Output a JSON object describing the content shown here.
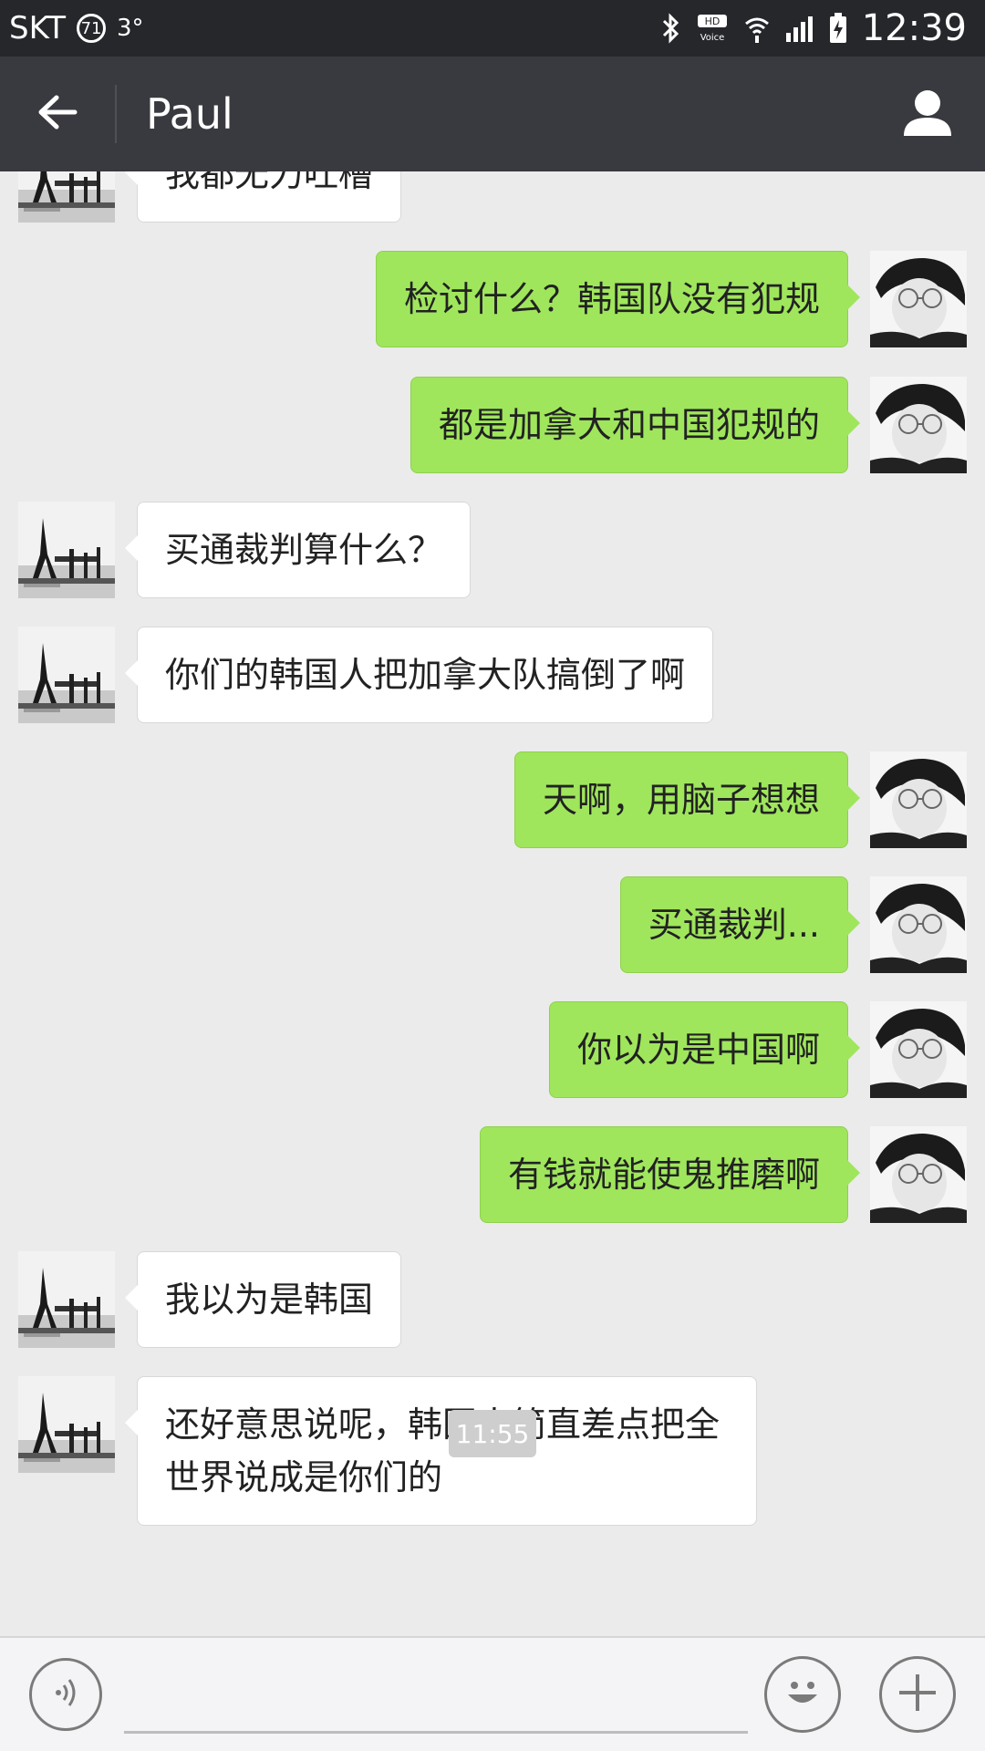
{
  "status_bar": {
    "carrier": "SKT",
    "badge": "71",
    "temperature": "3°",
    "hd_voice": "HD",
    "voice_label": "Voice",
    "time": "12:39"
  },
  "header": {
    "title": "Paul"
  },
  "messages": [
    {
      "side": "left",
      "text": "我都无力吐槽"
    },
    {
      "side": "right",
      "text": "检讨什么？韩国队没有犯规"
    },
    {
      "side": "right",
      "text": "都是加拿大和中国犯规的"
    },
    {
      "side": "left",
      "text": "买通裁判算什么？"
    },
    {
      "side": "left",
      "text": "你们的韩国人把加拿大队搞倒了啊"
    },
    {
      "side": "right",
      "text": "天啊，用脑子想想"
    },
    {
      "side": "right",
      "text": "买通裁判..."
    },
    {
      "side": "right",
      "text": "你以为是中国啊"
    },
    {
      "side": "right",
      "text": "有钱就能使鬼推磨啊"
    },
    {
      "side": "left",
      "text": "我以为是韩国"
    },
    {
      "side": "left",
      "text": "还好意思说呢，韩国人简直差点把全世界说成是你们的"
    }
  ],
  "timestamp": "11:55",
  "input": {
    "value": "",
    "placeholder": ""
  },
  "colors": {
    "status_bar": "#25272b",
    "title_bar": "#393a3f",
    "chat_background": "#ebebeb",
    "sent_bubble": "#9fe65c",
    "received_bubble": "#ffffff"
  },
  "icons": {
    "back": "arrow-left-icon",
    "profile": "person-icon",
    "voice": "voice-wave-icon",
    "emoji": "smiley-icon",
    "plus": "plus-icon"
  }
}
